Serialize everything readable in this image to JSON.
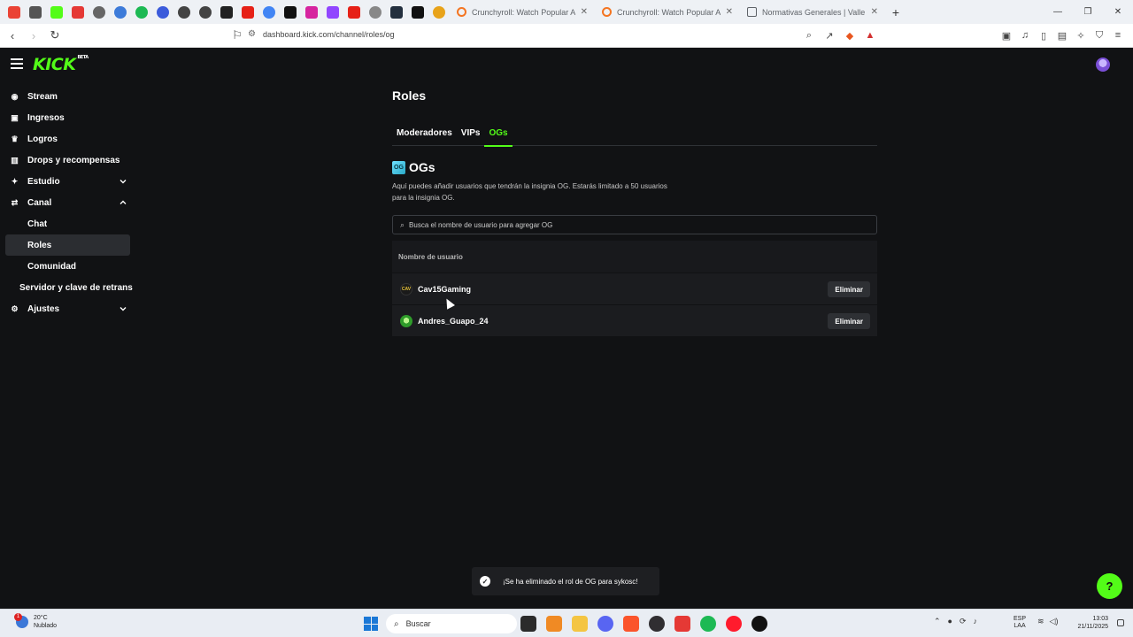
{
  "browser": {
    "tabs": [
      {
        "title": "Crunchyroll: Watch Popular Anime, Pl",
        "active": false
      },
      {
        "title": "Crunchyroll: Watch Popular Anime, Pl",
        "active": false
      },
      {
        "title": "Normativas Generales | Valle Sagrado",
        "active": false
      }
    ],
    "new_tab_label": "+",
    "url": "dashboard.kick.com/channel/roles/og"
  },
  "app": {
    "logo": "KICK",
    "logo_tag": "BETA",
    "colors": {
      "accent": "#53fc18",
      "background": "#111214"
    }
  },
  "sidebar": {
    "items": [
      {
        "label": "Stream",
        "icon": "broadcast-icon"
      },
      {
        "label": "Ingresos",
        "icon": "wallet-icon"
      },
      {
        "label": "Logros",
        "icon": "trophy-icon"
      },
      {
        "label": "Drops y recompensas",
        "icon": "gift-icon"
      },
      {
        "label": "Estudio",
        "icon": "studio-icon",
        "expanded": false
      },
      {
        "label": "Canal",
        "icon": "channel-icon",
        "expanded": true
      },
      {
        "label": "Chat"
      },
      {
        "label": "Roles",
        "selected": true
      },
      {
        "label": "Comunidad"
      },
      {
        "label": "Servidor y clave de retrans"
      },
      {
        "label": "Ajustes",
        "icon": "gear-icon",
        "expanded": false
      }
    ]
  },
  "main": {
    "title": "Roles",
    "tabs": [
      {
        "label": "Moderadores",
        "active": false
      },
      {
        "label": "VIPs",
        "active": false
      },
      {
        "label": "OGs",
        "active": true
      }
    ],
    "section_title": "OGs",
    "section_badge": "OG",
    "description": "Aquí puedes añadir usuarios que tendrán la insignia OG. Estarás limitado a 50 usuarios para la insignia OG.",
    "search_placeholder": "Busca el nombre de usuario para agregar OG",
    "table": {
      "header": "Nombre de usuario",
      "rows": [
        {
          "username": "Cav15Gaming",
          "avatar_text": "CAV",
          "action": "Eliminar"
        },
        {
          "username": "Andres_Guapo_24",
          "avatar_text": "",
          "action": "Eliminar"
        }
      ]
    }
  },
  "toast": {
    "message": "¡Se ha eliminado el rol de OG para sykosc!"
  },
  "taskbar": {
    "weather_temp": "20°C",
    "weather_desc": "Nublado",
    "weather_badge": "1",
    "search_label": "Buscar",
    "lang_line1": "ESP",
    "lang_line2": "LAA",
    "time": "13:03",
    "date": "21/11/2025"
  }
}
